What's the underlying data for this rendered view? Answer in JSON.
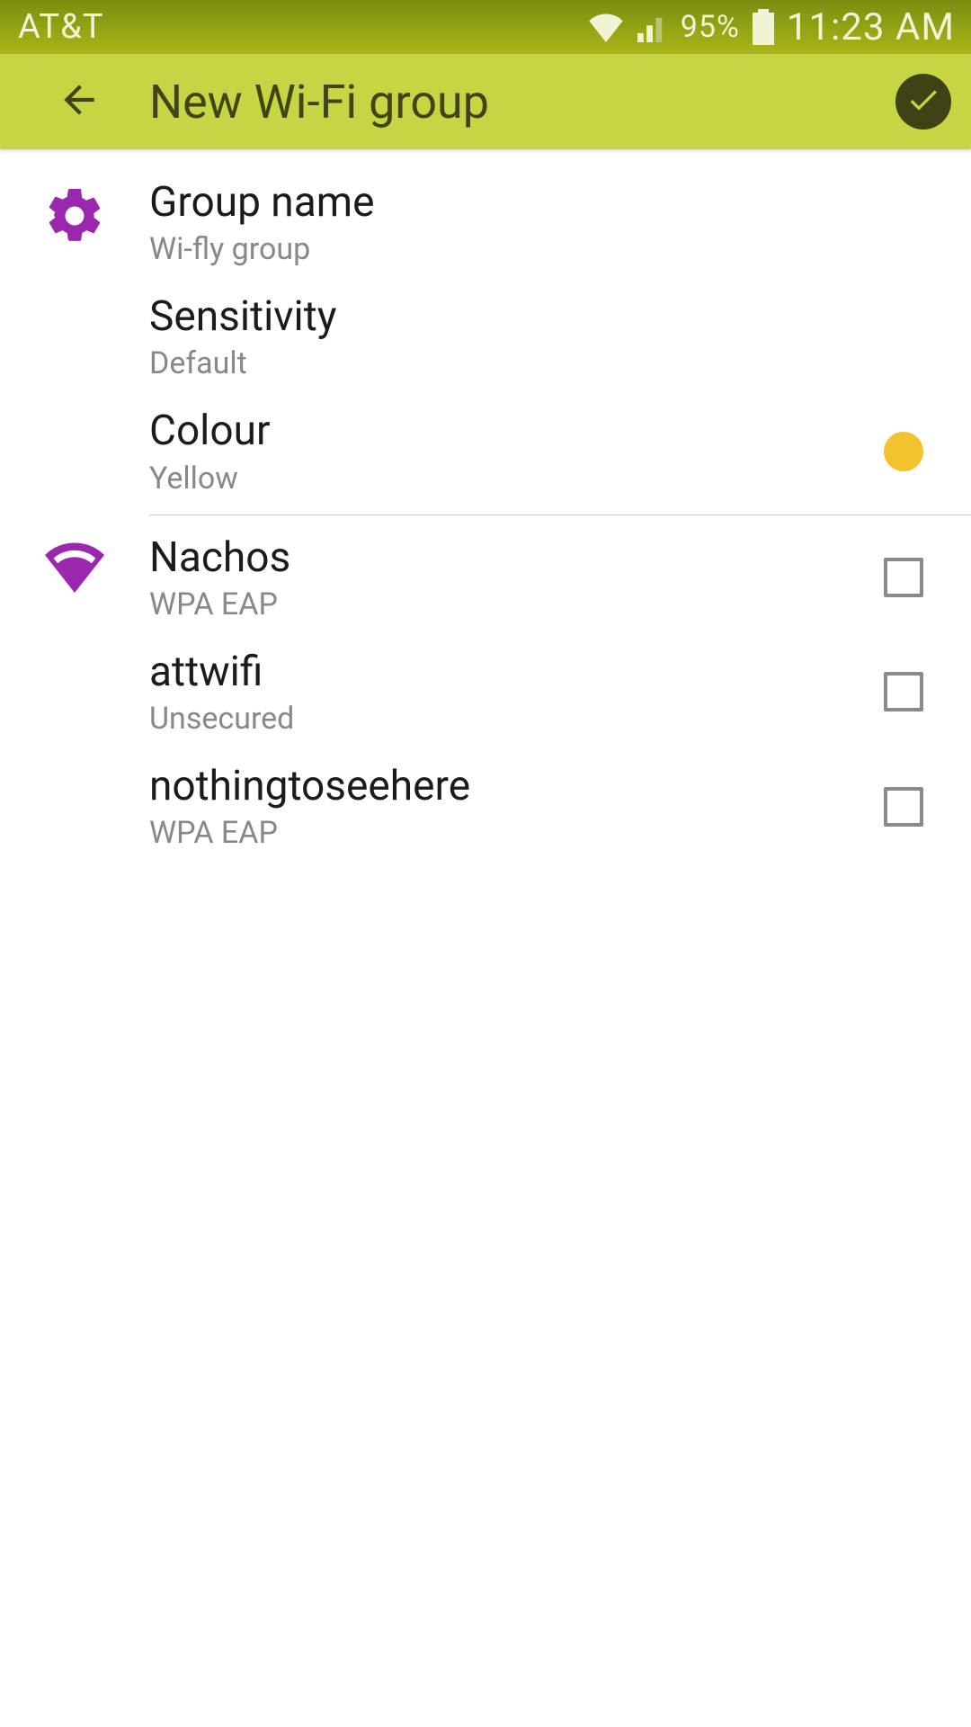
{
  "status": {
    "carrier": "AT&T",
    "battery_pct": "95%",
    "time": "11:23 AM"
  },
  "appbar": {
    "title": "New Wi-Fi group"
  },
  "settings": {
    "group_name": {
      "title": "Group name",
      "value": "Wi-fly group"
    },
    "sensitivity": {
      "title": "Sensitivity",
      "value": "Default"
    },
    "colour": {
      "title": "Colour",
      "value": "Yellow",
      "swatch": "#f2c32c"
    }
  },
  "networks": [
    {
      "ssid": "Nachos",
      "security": "WPA EAP",
      "checked": false
    },
    {
      "ssid": "attwifi",
      "security": "Unsecured",
      "checked": false
    },
    {
      "ssid": "nothingtoseehere",
      "security": "WPA EAP",
      "checked": false
    }
  ],
  "colors": {
    "accent": "#9b27af",
    "appbar_bg": "#c7d544",
    "appbar_fg": "#414415"
  }
}
